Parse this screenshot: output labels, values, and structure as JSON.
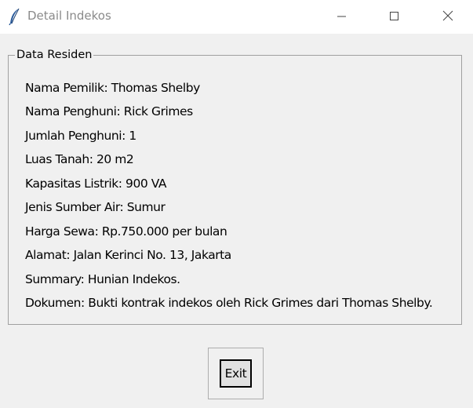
{
  "window": {
    "title": "Detail Indekos",
    "app_icon": "feather-icon",
    "controls": [
      "minimize-icon",
      "maximize-icon",
      "close-icon"
    ]
  },
  "group": {
    "legend": "Data Residen",
    "fields": [
      "Nama Pemilik: Thomas Shelby",
      "Nama Penghuni: Rick Grimes",
      "Jumlah Penghuni: 1",
      "Luas Tanah: 20 m2",
      "Kapasitas Listrik: 900 VA",
      "Jenis Sumber Air: Sumur",
      "Harga Sewa: Rp.750.000 per bulan",
      "Alamat: Jalan Kerinci No. 13, Jakarta",
      "Summary: Hunian Indekos.",
      "Dokumen: Bukti kontrak indekos oleh Rick Grimes dari Thomas Shelby."
    ]
  },
  "actions": {
    "exit_label": "Exit"
  },
  "colors": {
    "window_bg": "#f0f0f0",
    "titlebar_bg": "#ffffff",
    "title_text": "#8a8a8a",
    "button_face": "#e1e1e1"
  }
}
